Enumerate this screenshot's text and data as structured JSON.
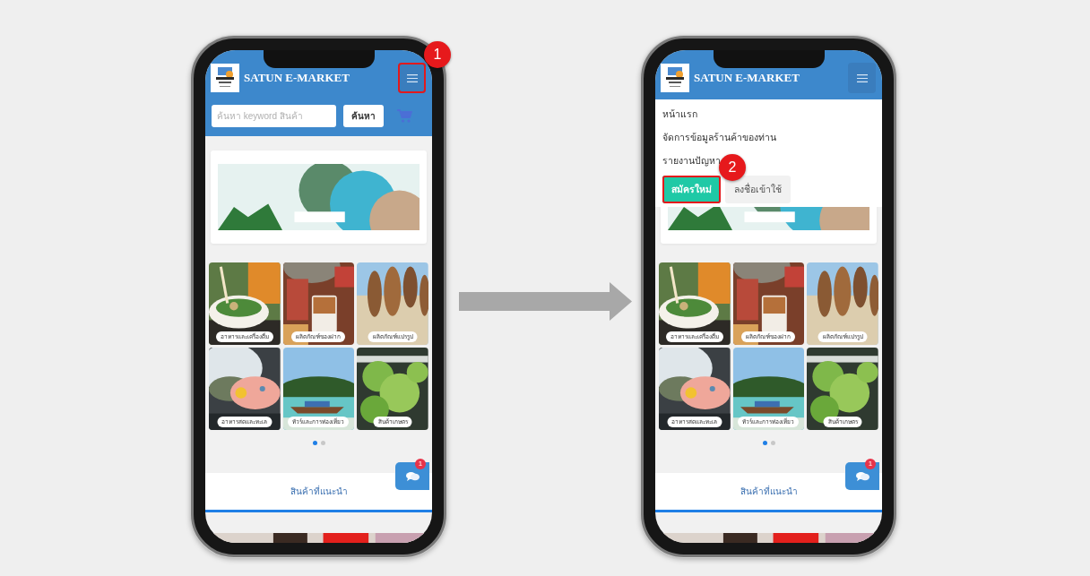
{
  "phones": [
    {
      "header": {
        "title": "SATUN E-MARKET",
        "menu_button": {
          "highlighted": true,
          "callout": "1"
        }
      },
      "search": {
        "placeholder": "ค้นหา keyword สินค้า",
        "button": "ค้นหา"
      },
      "categories": [
        {
          "label": "อาหารและเครื่องดื่ม",
          "kind": "food"
        },
        {
          "label": "ผลิตภัณฑ์ของฝาก",
          "kind": "souvenir"
        },
        {
          "label": "ผลิตภัณฑ์แปรรูป",
          "kind": "processed"
        },
        {
          "label": "อาหารสดและทะเล",
          "kind": "seafood"
        },
        {
          "label": "ทัวร์และการท่องเที่ยว",
          "kind": "tour"
        },
        {
          "label": "สินค้าเกษตร",
          "kind": "agriculture"
        }
      ],
      "carousel_dots": [
        {
          "selected": true
        },
        {
          "selected": false
        }
      ],
      "section_tab": {
        "label": "สินค้าที่แนะนำ",
        "selected": true
      },
      "chat_button": {
        "badge": "1"
      }
    },
    {
      "header": {
        "title": "SATUN E-MARKET",
        "menu_button": {
          "highlighted": false
        }
      },
      "menu": {
        "items": [
          "หน้าแรก",
          "จัดการข้อมูลร้านค้าของท่าน",
          "รายงานปัญหา"
        ],
        "buttons": [
          {
            "label": "สมัครใหม่",
            "kind": "primary",
            "highlighted": true,
            "callout": "2"
          },
          {
            "label": "ลงชื่อเข้าใช้",
            "kind": "secondary",
            "highlighted": false
          }
        ]
      },
      "categories": [
        {
          "label": "อาหารและเครื่องดื่ม",
          "kind": "food"
        },
        {
          "label": "ผลิตภัณฑ์ของฝาก",
          "kind": "souvenir"
        },
        {
          "label": "ผลิตภัณฑ์แปรรูป",
          "kind": "processed"
        },
        {
          "label": "อาหารสดและทะเล",
          "kind": "seafood"
        },
        {
          "label": "ทัวร์และการท่องเที่ยว",
          "kind": "tour"
        },
        {
          "label": "สินค้าเกษตร",
          "kind": "agriculture"
        }
      ],
      "carousel_dots": [
        {
          "selected": true
        },
        {
          "selected": false
        }
      ],
      "section_tab": {
        "label": "สินค้าที่แนะนำ",
        "selected": true
      },
      "chat_button": {
        "badge": "1"
      }
    }
  ]
}
